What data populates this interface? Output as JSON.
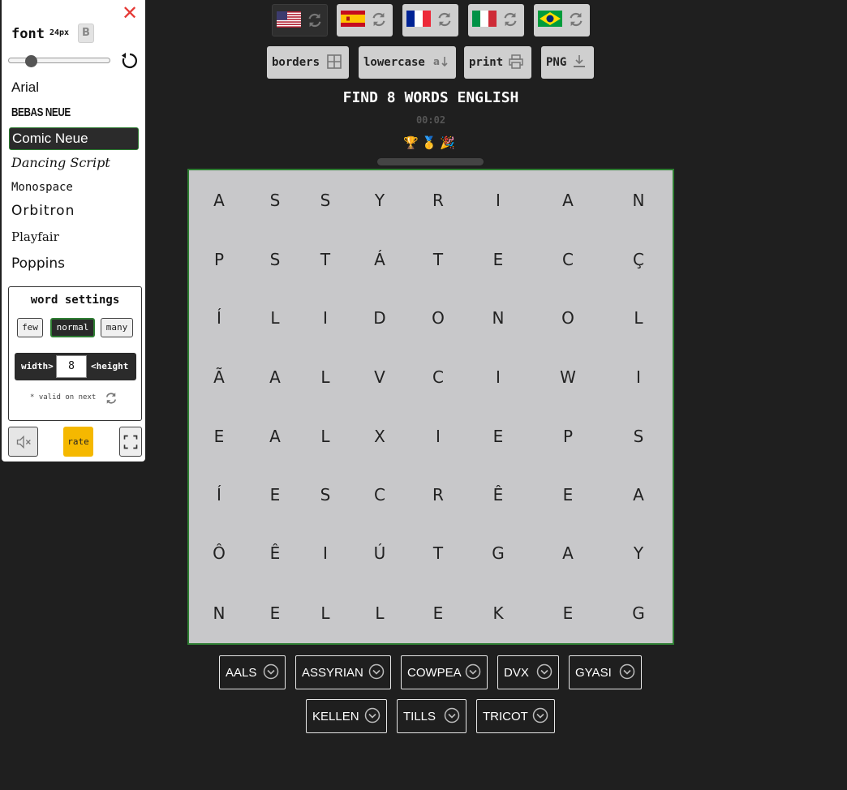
{
  "settings": {
    "close_label": "✕",
    "font_label": "font",
    "font_size": "24px",
    "bold_label": "B",
    "fonts": [
      "Arial",
      "BEBAS NEUE",
      "Comic Neue",
      "Dancing Script",
      "Monospace",
      "Orbitron",
      "Playfair",
      "Poppins"
    ],
    "active_font": "Comic Neue",
    "word_settings": {
      "title": "word settings",
      "density": [
        "few",
        "normal",
        "many"
      ],
      "selected_density": "normal",
      "width_label": "width>",
      "size_value": "8",
      "height_label": "<height",
      "note": "* valid on next"
    },
    "rate_label": "rate"
  },
  "languages": [
    {
      "code": "us",
      "selected": true
    },
    {
      "code": "es",
      "selected": false
    },
    {
      "code": "fr",
      "selected": false
    },
    {
      "code": "it",
      "selected": false
    },
    {
      "code": "br",
      "selected": false
    }
  ],
  "tools": {
    "borders": "borders",
    "lowercase": "lowercase",
    "print": "print",
    "png": "PNG"
  },
  "game": {
    "title": "FIND 8 WORDS ENGLISH",
    "timer": "00:02",
    "awards": "🏆🥇🎉"
  },
  "grid": [
    [
      "A",
      "S",
      "S",
      "Y",
      "R",
      "I",
      "A",
      "N"
    ],
    [
      "P",
      "S",
      "T",
      "Á",
      "T",
      "E",
      "C",
      "Ç"
    ],
    [
      "Í",
      "L",
      "I",
      "D",
      "O",
      "N",
      "O",
      "L"
    ],
    [
      "Ã",
      "A",
      "L",
      "V",
      "C",
      "I",
      "W",
      "I"
    ],
    [
      "E",
      "A",
      "L",
      "X",
      "I",
      "E",
      "P",
      "S"
    ],
    [
      "Í",
      "E",
      "S",
      "C",
      "R",
      "Ê",
      "E",
      "A"
    ],
    [
      "Ô",
      "Ê",
      "I",
      "Ú",
      "T",
      "G",
      "A",
      "Y"
    ],
    [
      "N",
      "E",
      "L",
      "L",
      "E",
      "K",
      "E",
      "G"
    ]
  ],
  "words": [
    "AALS",
    "ASSYRIAN",
    "COWPEA",
    "DVX",
    "GYASI",
    "KELLEN",
    "TILLS",
    "TRICOT"
  ],
  "colors": {
    "background": "#1f1f1f",
    "grid_bg": "#c8c8ca",
    "grid_border": "#2e7d32",
    "rate": "#f5b800",
    "close": "#e53935"
  }
}
